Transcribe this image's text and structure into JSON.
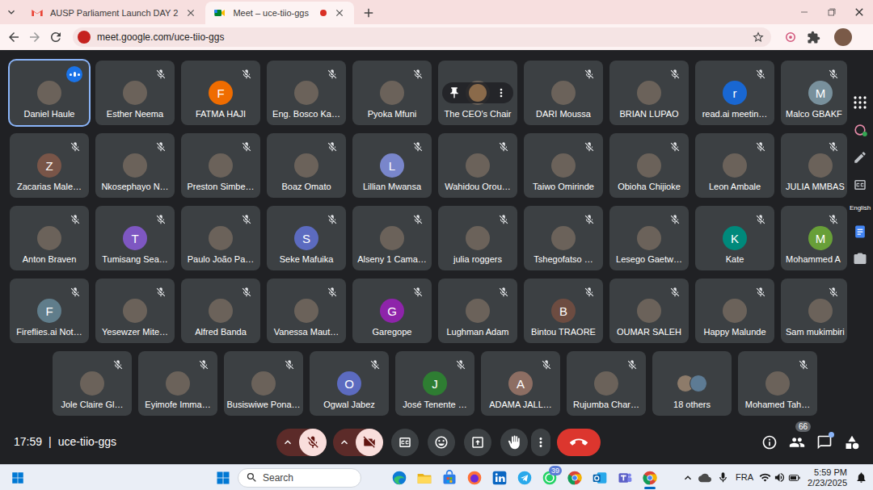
{
  "browser": {
    "tabs": [
      {
        "label": "AUSP Parliament Launch DAY 2",
        "kind": "gmail",
        "selected": false,
        "recording": false
      },
      {
        "label": "Meet – uce-tiio-ggs",
        "kind": "meet",
        "selected": true,
        "recording": true
      }
    ],
    "address": "meet.google.com/uce-tiio-ggs"
  },
  "meeting": {
    "participants": [
      {
        "name": "Daniel Haule",
        "kind": "photo",
        "muted": false,
        "speaking": true,
        "hovered": false
      },
      {
        "name": "Esther Neema",
        "kind": "photo",
        "muted": true,
        "speaking": false,
        "hovered": false
      },
      {
        "name": "FATMA HAJI",
        "kind": "letter",
        "letter": "F",
        "color": "#ef6c00",
        "muted": true,
        "speaking": false,
        "hovered": false
      },
      {
        "name": "Eng. Bosco Ka…",
        "kind": "photo",
        "muted": true,
        "speaking": false,
        "hovered": false
      },
      {
        "name": "Pyoka Mfuni",
        "kind": "photo",
        "muted": true,
        "speaking": false,
        "hovered": false
      },
      {
        "name": "The CEO's Chair",
        "kind": "photo",
        "muted": false,
        "speaking": false,
        "hovered": true
      },
      {
        "name": "DARI Moussa",
        "kind": "photo",
        "muted": true,
        "speaking": false,
        "hovered": false
      },
      {
        "name": "BRIAN LUPAO",
        "kind": "photo",
        "muted": true,
        "speaking": false,
        "hovered": false
      },
      {
        "name": "read.ai meetin…",
        "kind": "letter",
        "letter": "r",
        "color": "#1967d2",
        "muted": true,
        "speaking": false,
        "hovered": false
      },
      {
        "name": "Malco GBAKF",
        "kind": "letter",
        "letter": "M",
        "color": "#78909c",
        "muted": true,
        "speaking": false,
        "hovered": false
      },
      {
        "name": "Zacarias Male…",
        "kind": "letter",
        "letter": "Z",
        "color": "#795548",
        "muted": true,
        "speaking": false,
        "hovered": false
      },
      {
        "name": "Nkosephayo N…",
        "kind": "photo",
        "muted": true,
        "speaking": false,
        "hovered": false
      },
      {
        "name": "Preston Simbe…",
        "kind": "photo",
        "muted": true,
        "speaking": false,
        "hovered": false
      },
      {
        "name": "Boaz Omato",
        "kind": "photo",
        "muted": true,
        "speaking": false,
        "hovered": false
      },
      {
        "name": "Lillian Mwansa",
        "kind": "letter",
        "letter": "L",
        "color": "#7986cb",
        "muted": true,
        "speaking": false,
        "hovered": false
      },
      {
        "name": "Wahidou Orou…",
        "kind": "photo",
        "muted": true,
        "speaking": false,
        "hovered": false
      },
      {
        "name": "Taiwo Omirinde",
        "kind": "photo",
        "muted": true,
        "speaking": false,
        "hovered": false
      },
      {
        "name": "Obioha Chijioke",
        "kind": "photo",
        "muted": true,
        "speaking": false,
        "hovered": false
      },
      {
        "name": "Leon Ambale",
        "kind": "photo",
        "muted": true,
        "speaking": false,
        "hovered": false
      },
      {
        "name": "JULIA MMBAS",
        "kind": "photo",
        "muted": true,
        "speaking": false,
        "hovered": false
      },
      {
        "name": "Anton Braven",
        "kind": "photo",
        "muted": true,
        "speaking": false,
        "hovered": false
      },
      {
        "name": "Tumisang Sea…",
        "kind": "letter",
        "letter": "T",
        "color": "#7e57c2",
        "muted": true,
        "speaking": false,
        "hovered": false
      },
      {
        "name": "Paulo João Pa…",
        "kind": "photo",
        "muted": true,
        "speaking": false,
        "hovered": false
      },
      {
        "name": "Seke Mafuika",
        "kind": "letter",
        "letter": "S",
        "color": "#5c6bc0",
        "muted": true,
        "speaking": false,
        "hovered": false
      },
      {
        "name": "Alseny 1 Cama…",
        "kind": "photo",
        "muted": true,
        "speaking": false,
        "hovered": false
      },
      {
        "name": "julia roggers",
        "kind": "photo",
        "muted": true,
        "speaking": false,
        "hovered": false
      },
      {
        "name": "Tshegofatso …",
        "kind": "photo",
        "muted": true,
        "speaking": false,
        "hovered": false
      },
      {
        "name": "Lesego Gaetw…",
        "kind": "photo",
        "muted": true,
        "speaking": false,
        "hovered": false
      },
      {
        "name": "Kate",
        "kind": "letter",
        "letter": "K",
        "color": "#00897b",
        "muted": true,
        "speaking": false,
        "hovered": false
      },
      {
        "name": "Mohammed A",
        "kind": "letter",
        "letter": "M",
        "color": "#689f38",
        "muted": true,
        "speaking": false,
        "hovered": false
      },
      {
        "name": "Fireflies.ai Not…",
        "kind": "letter",
        "letter": "F",
        "color": "#607d8b",
        "muted": true,
        "speaking": false,
        "hovered": false
      },
      {
        "name": "Yesewzer Mite…",
        "kind": "photo",
        "muted": true,
        "speaking": false,
        "hovered": false
      },
      {
        "name": "Alfred Banda",
        "kind": "photo",
        "muted": true,
        "speaking": false,
        "hovered": false
      },
      {
        "name": "Vanessa Maut…",
        "kind": "photo",
        "muted": true,
        "speaking": false,
        "hovered": false
      },
      {
        "name": "Garegope",
        "kind": "letter",
        "letter": "G",
        "color": "#8e24aa",
        "muted": true,
        "speaking": false,
        "hovered": false
      },
      {
        "name": "Lughman Adam",
        "kind": "photo",
        "muted": true,
        "speaking": false,
        "hovered": false
      },
      {
        "name": "Bintou TRAORE",
        "kind": "letter",
        "letter": "B",
        "color": "#6d4c41",
        "muted": true,
        "speaking": false,
        "hovered": false
      },
      {
        "name": "OUMAR SALEH",
        "kind": "photo",
        "muted": true,
        "speaking": false,
        "hovered": false
      },
      {
        "name": "Happy Malunde",
        "kind": "photo",
        "muted": true,
        "speaking": false,
        "hovered": false
      },
      {
        "name": "Sam mukimbiri",
        "kind": "photo",
        "muted": true,
        "speaking": false,
        "hovered": false
      },
      {
        "name": "Jole Claire Gl…",
        "kind": "photo",
        "muted": true,
        "speaking": false,
        "hovered": false
      },
      {
        "name": "Eyimofe Imma…",
        "kind": "photo",
        "muted": true,
        "speaking": false,
        "hovered": false
      },
      {
        "name": "Busiswiwe Pona…",
        "kind": "photo",
        "muted": true,
        "speaking": false,
        "hovered": false
      },
      {
        "name": "Ogwal Jabez",
        "kind": "letter",
        "letter": "O",
        "color": "#5c6bc0",
        "muted": true,
        "speaking": false,
        "hovered": false
      },
      {
        "name": "José Tenente …",
        "kind": "letter",
        "letter": "J",
        "color": "#2e7d32",
        "muted": true,
        "speaking": false,
        "hovered": false
      },
      {
        "name": "ADAMA JALL…",
        "kind": "letter",
        "letter": "A",
        "color": "#8d6e63",
        "muted": true,
        "speaking": false,
        "hovered": false
      },
      {
        "name": "Rujumba Char…",
        "kind": "photo",
        "muted": true,
        "speaking": false,
        "hovered": false
      },
      {
        "name": "18 others",
        "kind": "others",
        "muted": false,
        "speaking": false,
        "hovered": false
      },
      {
        "name": "Mohamed Tah…",
        "kind": "photo",
        "muted": true,
        "speaking": false,
        "hovered": false
      }
    ],
    "side_panel": {
      "language": "English"
    },
    "bottom_bar": {
      "time": "17:59",
      "separator": "|",
      "code": "uce-tiio-ggs",
      "mic_muted": true,
      "camera_off": true,
      "people_count": "66",
      "chat_unread": true
    }
  },
  "taskbar": {
    "search_placeholder": "Search",
    "apps": [
      {
        "kind": "edge",
        "active": false
      },
      {
        "kind": "explorer",
        "active": false
      },
      {
        "kind": "store",
        "active": false
      },
      {
        "kind": "firefox",
        "active": false
      },
      {
        "kind": "linkedin",
        "active": false
      },
      {
        "kind": "telegram",
        "active": false
      },
      {
        "kind": "whatsapp",
        "active": false,
        "badge": "39"
      },
      {
        "kind": "chrome",
        "active": false
      },
      {
        "kind": "outlook",
        "active": false
      },
      {
        "kind": "teams",
        "active": false
      },
      {
        "kind": "chrome",
        "active": true
      }
    ],
    "tray": {
      "language": "FRA",
      "time": "5:59 PM",
      "date": "2/23/2025"
    }
  }
}
